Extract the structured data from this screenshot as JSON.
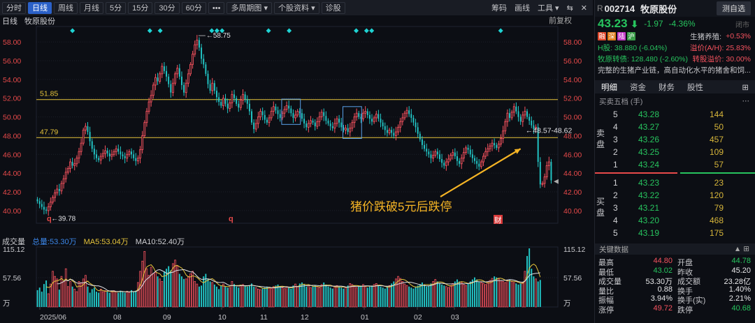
{
  "toolbar": {
    "items": [
      {
        "label": "分时",
        "active": false
      },
      {
        "label": "日线",
        "active": true
      },
      {
        "label": "周线",
        "active": false
      },
      {
        "label": "月线",
        "active": false
      },
      {
        "label": "5分",
        "active": false
      },
      {
        "label": "15分",
        "active": false
      },
      {
        "label": "30分",
        "active": false
      },
      {
        "label": "60分",
        "active": false
      },
      {
        "label": "•••",
        "active": false
      },
      {
        "label": "多周期图 ▾",
        "active": false
      },
      {
        "label": "个股资料 ▾",
        "active": false
      },
      {
        "label": "诊股",
        "active": false
      }
    ],
    "right": [
      "筹码",
      "画线",
      "工具 ▾",
      "⇆",
      "✕"
    ]
  },
  "chart_info": {
    "period": "日线",
    "name": "牧原股份",
    "right_label": "前复权"
  },
  "chart_data": {
    "type": "candlestick",
    "ylim": [
      38.8,
      59.5
    ],
    "y_ticks": [
      40.0,
      42.0,
      44.0,
      46.0,
      48.0,
      50.0,
      52.0,
      54.0,
      56.0,
      58.0
    ],
    "hlines": [
      {
        "label": "51.85",
        "value": 51.85
      },
      {
        "label": "47.79",
        "value": 47.79
      }
    ],
    "high_label": "58.75",
    "low_label": "39.78",
    "range_label": "48.57-48.62",
    "x_labels": [
      "2025/06",
      "08",
      "09",
      "10",
      "11",
      "12",
      "01",
      "02",
      "03"
    ],
    "volume": {
      "max_label": "115.12",
      "mid_label": "57.56",
      "unit": "万",
      "total": "总量:53.30万",
      "ma5": "MA5:53.04万",
      "ma10": "MA10:52.40万"
    },
    "annotation": "猪价跌破5元后跌停",
    "markers": {
      "q": "q",
      "cai": "财"
    },
    "closes": [
      41.0,
      40.7,
      40.4,
      40.1,
      40.0,
      40.4,
      40.9,
      41.4,
      41.9,
      42.3,
      42.1,
      42.9,
      43.4,
      44.1,
      44.5,
      45.2,
      44.8,
      45.0,
      45.6,
      46.3,
      47.2,
      48.6,
      49.0,
      48.4,
      47.4,
      46.6,
      46.0,
      45.6,
      45.4,
      45.8,
      46.1,
      46.4,
      46.1,
      45.8,
      46.0,
      46.3,
      46.6,
      46.3,
      46.0,
      45.8,
      45.6,
      46.0,
      46.3,
      46.0,
      45.6,
      45.3,
      45.6,
      46.5,
      48.0,
      49.4,
      50.6,
      51.6,
      52.3,
      53.4,
      54.2,
      53.8,
      54.6,
      55.4,
      54.9,
      54.3,
      53.5,
      52.6,
      53.6,
      54.6,
      55.2,
      54.3,
      53.4,
      52.6,
      53.6,
      54.6,
      55.6,
      56.7,
      57.7,
      58.2,
      57.4,
      56.2,
      55.6,
      54.6,
      53.5,
      52.8,
      53.6,
      52.8,
      52.1,
      51.6,
      51.2,
      52.0,
      51.4,
      50.9,
      51.5,
      52.4,
      52.0,
      51.4,
      51.0,
      51.8,
      52.4,
      51.9,
      51.4,
      50.6,
      49.4,
      48.7,
      49.3,
      50.0,
      50.6,
      50.2,
      49.7,
      49.4,
      49.9,
      50.6,
      51.1,
      50.7,
      50.3,
      49.9,
      50.4,
      50.8,
      51.2,
      50.9,
      50.4,
      49.9,
      50.2,
      50.6,
      50.4,
      49.8,
      49.3,
      48.9,
      49.3,
      49.6,
      49.4,
      49.0,
      49.5,
      50.0,
      50.5,
      50.1,
      49.6,
      49.3,
      49.0,
      48.8,
      49.3,
      49.8,
      49.4,
      48.9,
      48.6,
      48.8,
      48.4,
      48.8,
      49.4,
      50.0,
      50.4,
      50.0,
      49.8,
      50.4,
      50.6,
      50.2,
      49.8,
      49.5,
      49.9,
      50.3,
      49.8,
      49.4,
      49.0,
      48.6,
      48.3,
      48.6,
      48.3,
      48.0,
      48.4,
      48.9,
      49.5,
      49.9,
      50.4,
      50.7,
      50.3,
      49.9,
      49.4,
      48.9,
      48.2,
      47.6,
      47.0,
      46.6,
      46.3,
      46.0,
      45.6,
      45.9,
      46.3,
      46.0,
      45.5,
      45.1,
      44.8,
      45.2,
      45.5,
      45.9,
      46.2,
      45.8,
      45.3,
      45.0,
      45.6,
      46.2,
      46.7,
      46.5,
      46.0,
      45.6,
      45.3,
      45.0,
      44.7,
      45.2,
      45.8,
      46.3,
      46.6,
      46.9,
      47.2,
      47.0,
      46.7,
      47.1,
      47.7,
      48.5,
      49.5,
      50.4,
      49.9,
      50.5,
      51.1,
      50.6,
      50.0,
      49.5,
      50.2,
      50.6,
      50.0,
      49.6,
      49.1,
      48.7,
      48.9,
      45.2,
      42.8,
      42.9,
      43.6,
      44.8,
      45.2,
      43.23
    ],
    "volumes": [
      33,
      38,
      30,
      45,
      52,
      26,
      45,
      70,
      60,
      55,
      34,
      60,
      50,
      75,
      40,
      50,
      40,
      35,
      30,
      50,
      47,
      55,
      62,
      40,
      28,
      35,
      38,
      30,
      28,
      35,
      30,
      32,
      30,
      28,
      30,
      32,
      30,
      28,
      32,
      30,
      28,
      31,
      28,
      33,
      30,
      32,
      48,
      70,
      90,
      109,
      75,
      62,
      78,
      65,
      68,
      60,
      55,
      50,
      70,
      75,
      80,
      72,
      85,
      92,
      80,
      65,
      60,
      55,
      55,
      60,
      65,
      70,
      50,
      45,
      40,
      42,
      60,
      65,
      55,
      50,
      48,
      44,
      40,
      35,
      42,
      45,
      40,
      38,
      38,
      50,
      45,
      40,
      38,
      42,
      44,
      42,
      40,
      42,
      46,
      40,
      38,
      35,
      34,
      36,
      38,
      40,
      38,
      36,
      40,
      42,
      44,
      40,
      38,
      36,
      40,
      38,
      36,
      42,
      45,
      40,
      46,
      48,
      44,
      40,
      42,
      38,
      40,
      42,
      40,
      38,
      44,
      48,
      44,
      40,
      38,
      36,
      40,
      42,
      40,
      38,
      36,
      38,
      42,
      46,
      44,
      40,
      38,
      40,
      42,
      44,
      40,
      38,
      40,
      42,
      44,
      46,
      42,
      40,
      38,
      36,
      40,
      42,
      46,
      50,
      55,
      60,
      56,
      50,
      45,
      42,
      40,
      38,
      36,
      40,
      42,
      45,
      48,
      44,
      40,
      42,
      46,
      50,
      54,
      50,
      46,
      44,
      42,
      40,
      38,
      42,
      46,
      50,
      54,
      50,
      48,
      44,
      42,
      46,
      50,
      54,
      58,
      54,
      50,
      48,
      46,
      44,
      48,
      52,
      56,
      60,
      58,
      55,
      52,
      50,
      48,
      52,
      54,
      50,
      48,
      46,
      44,
      46,
      48,
      70,
      100,
      115,
      75,
      60,
      55,
      50,
      53
    ]
  },
  "quote": {
    "prefix": "R",
    "code": "002714",
    "name": "牧原股份",
    "return_button": "测自选",
    "price": "43.23",
    "arrow": "⬇",
    "change": "-1.97",
    "change_pct": "-4.36%",
    "status": "闭市",
    "badges": [
      {
        "t": "融",
        "c": "#e0482c"
      },
      {
        "t": "深",
        "c": "#e07c1a"
      },
      {
        "t": "陆",
        "c": "#c43ac8"
      },
      {
        "t": "沪",
        "c": "#3c9e4a"
      }
    ],
    "rows": [
      {
        "l": "生猪养殖:",
        "v": "+0.53%",
        "lc": "#c8c8cc",
        "vc": "#f5525e",
        "badges": true
      },
      {
        "l": "H股: 38.880 (-6.04%)",
        "v": "溢价(A/H): 25.83%",
        "lc": "#27c45e",
        "vc": "#f5525e",
        "split": true
      },
      {
        "l": "牧原转债: 128.480 (-2.60%)",
        "v": "转股溢价: 30.00%",
        "lc": "#27c45e",
        "vc": "#f5525e",
        "split": true
      },
      {
        "l": "完整的生猪产业链，高自动化水平的猪舍和饲...",
        "v": "",
        "lc": "#c8c8cc",
        "vc": "#c8c8cc"
      }
    ]
  },
  "tabs": [
    {
      "label": "明细",
      "active": true
    },
    {
      "label": "资金",
      "active": false
    },
    {
      "label": "财务",
      "active": false
    },
    {
      "label": "股性",
      "active": false
    },
    {
      "label": "⊞",
      "active": false
    }
  ],
  "orderbook": {
    "title": "买卖五档 (手)",
    "sell_label": "卖盘",
    "buy_label": "买盘",
    "sell": [
      {
        "lv": "5",
        "p": "43.28",
        "v": "144"
      },
      {
        "lv": "4",
        "p": "43.27",
        "v": "50"
      },
      {
        "lv": "3",
        "p": "43.26",
        "v": "457"
      },
      {
        "lv": "2",
        "p": "43.25",
        "v": "109"
      },
      {
        "lv": "1",
        "p": "43.24",
        "v": "57"
      }
    ],
    "buy": [
      {
        "lv": "1",
        "p": "43.23",
        "v": "23"
      },
      {
        "lv": "2",
        "p": "43.22",
        "v": "120"
      },
      {
        "lv": "3",
        "p": "43.21",
        "v": "79"
      },
      {
        "lv": "4",
        "p": "43.20",
        "v": "468"
      },
      {
        "lv": "5",
        "p": "43.19",
        "v": "175"
      }
    ]
  },
  "keydata": {
    "title": "关键数据",
    "rows": [
      {
        "a": "最高",
        "b": "44.80",
        "bc": "#f5525e",
        "c": "开盘",
        "d": "44.78",
        "dc": "#27c45e"
      },
      {
        "a": "最低",
        "b": "43.02",
        "bc": "#27c45e",
        "c": "昨收",
        "d": "45.20",
        "dc": "#e8e8ea"
      },
      {
        "a": "成交量",
        "b": "53.30万",
        "bc": "#e8e8ea",
        "c": "成交额",
        "d": "23.28亿",
        "dc": "#e8e8ea"
      },
      {
        "a": "量比",
        "b": "0.88",
        "bc": "#e8e8ea",
        "c": "换手",
        "d": "1.40%",
        "dc": "#e8e8ea"
      },
      {
        "a": "振幅",
        "b": "3.94%",
        "bc": "#e8e8ea",
        "c": "换手(实)",
        "d": "2.21%",
        "dc": "#e8e8ea"
      },
      {
        "a": "涨停",
        "b": "49.72",
        "bc": "#f5525e",
        "c": "跌停",
        "d": "40.68",
        "dc": "#27c45e"
      }
    ]
  },
  "colors": {
    "up": "#f5525e",
    "down": "#22c7c7",
    "green": "#27c45e",
    "gold": "#e6c43b",
    "accent": "#2b61c8"
  }
}
